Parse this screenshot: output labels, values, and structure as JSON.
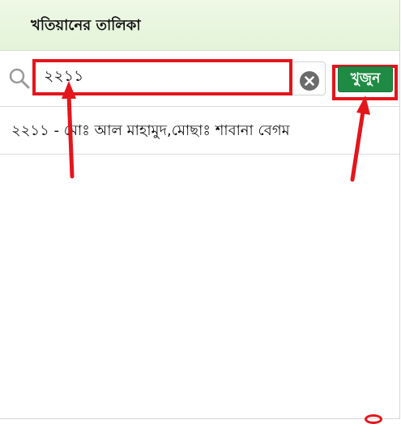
{
  "header": {
    "title": "খতিয়ানের তালিকা"
  },
  "search": {
    "value": "২২১১",
    "icon": "search-icon",
    "clear_icon": "clear-icon",
    "button_label": "খুজুন"
  },
  "results": [
    {
      "text": "২২১১ - মোঃ আল মাহামুদ,মোছাঃ শাবানা বেগম"
    }
  ],
  "colors": {
    "header_bg": "#e8f5df",
    "button_bg": "#1f8a43",
    "annotation_red": "#e4151b"
  },
  "annotations": [
    {
      "type": "arrow",
      "color": "#e4151b",
      "target": "search-input"
    },
    {
      "type": "arrow",
      "color": "#e4151b",
      "target": "find-button"
    }
  ]
}
